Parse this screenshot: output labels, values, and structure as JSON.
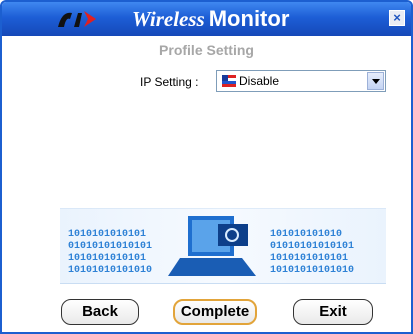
{
  "window": {
    "title_part1": "Wireless",
    "title_part2": "Monitor",
    "close_symbol": "×"
  },
  "content": {
    "subtitle": "Profile Setting",
    "ip_setting": {
      "label": "IP Setting :",
      "value": "Disable",
      "icon": "network-adapter-icon"
    }
  },
  "buttons": {
    "back": "Back",
    "complete": "Complete",
    "exit": "Exit"
  },
  "colors": {
    "titlebar": "#1d5ed6",
    "logo_red": "#e02020",
    "subtitle": "#a7a7a7",
    "banner_blue": "#2f82d6",
    "complete_border": "#e2a43a"
  }
}
